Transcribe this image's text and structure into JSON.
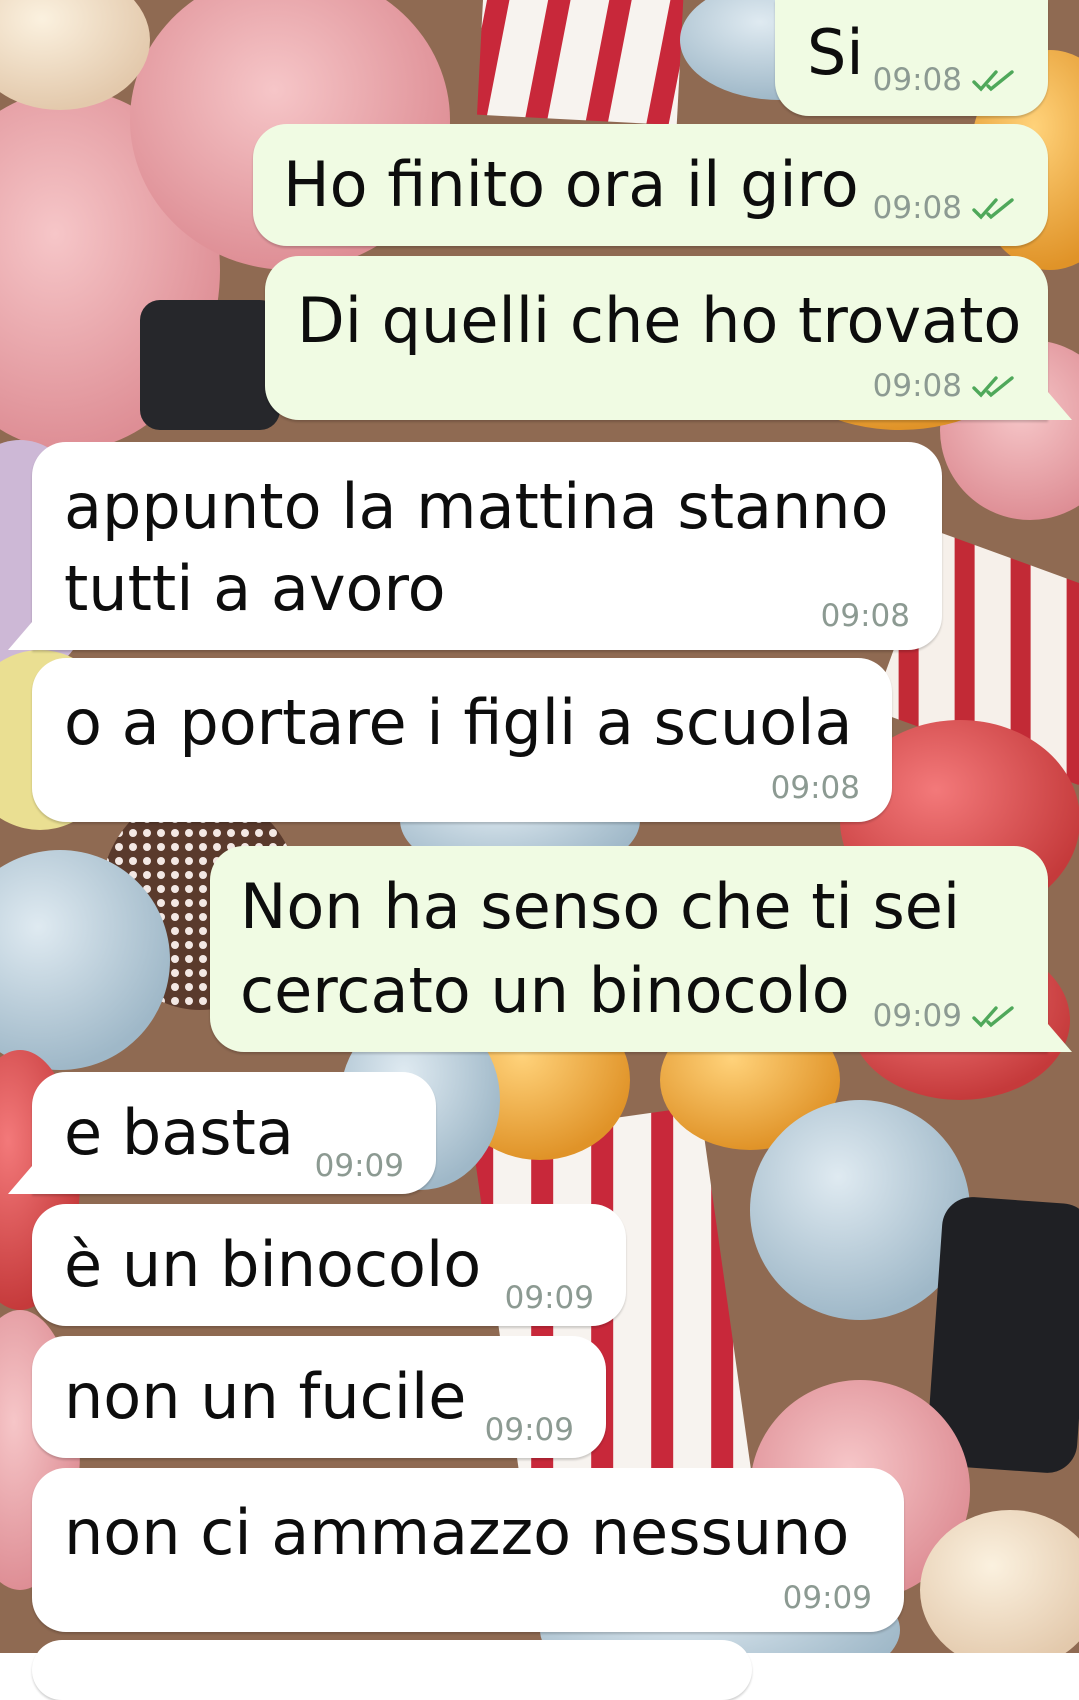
{
  "chat": {
    "messages": [
      {
        "direction": "outgoing",
        "text": "Si",
        "time": "09:08",
        "status": "read"
      },
      {
        "direction": "outgoing",
        "text": "Ho finito ora il giro",
        "time": "09:08",
        "status": "read"
      },
      {
        "direction": "outgoing",
        "text": "Di quelli che ho trovato",
        "time": "09:08",
        "status": "read"
      },
      {
        "direction": "incoming",
        "lines": [
          "appunto la mattina stanno",
          "tutti a avoro"
        ],
        "time": "09:08"
      },
      {
        "direction": "incoming",
        "text": "o a portare i figli a scuola",
        "time": "09:08"
      },
      {
        "direction": "outgoing",
        "lines": [
          "Non ha senso che ti sei",
          "cercato un binocolo"
        ],
        "time": "09:09",
        "status": "read"
      },
      {
        "direction": "incoming",
        "text": "e basta",
        "time": "09:09"
      },
      {
        "direction": "incoming",
        "text": "è un binocolo",
        "time": "09:09"
      },
      {
        "direction": "incoming",
        "text": "non un fucile",
        "time": "09:09"
      },
      {
        "direction": "incoming",
        "text": "non ci ammazzo nessuno",
        "time": "09:09"
      }
    ]
  },
  "colors": {
    "outgoing_bubble": "#f0fbe3",
    "incoming_bubble": "#ffffff",
    "read_tick": "#4fa85a",
    "timestamp": "#8c9a92"
  },
  "icons": {
    "read_status": "double-check-icon"
  }
}
